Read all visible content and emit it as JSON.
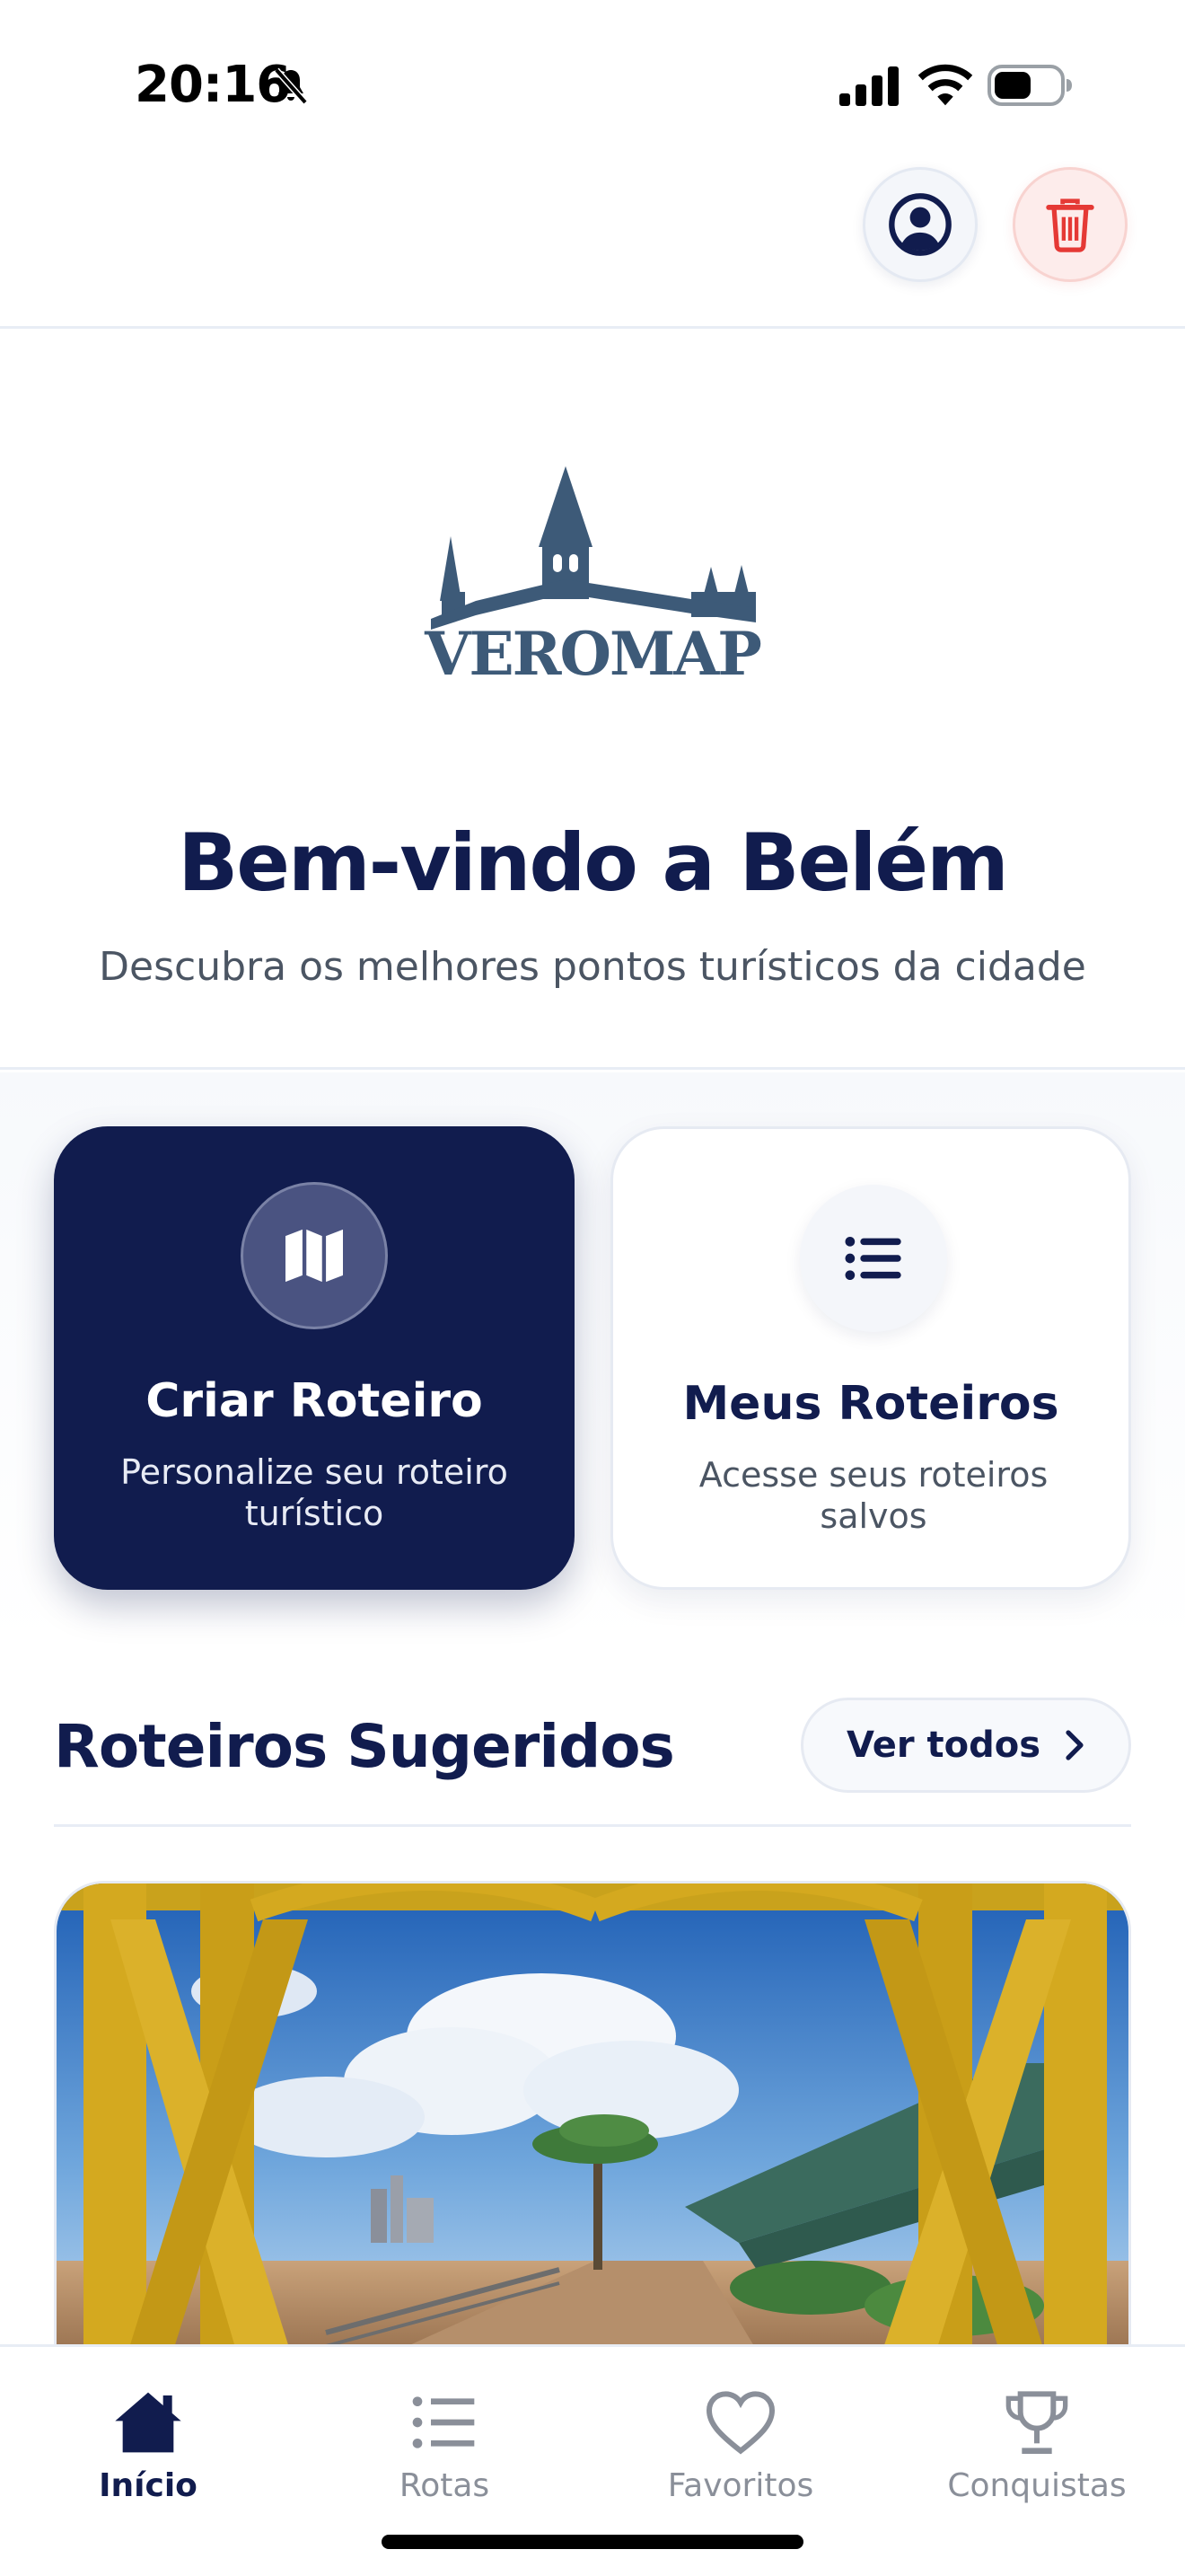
{
  "status_bar": {
    "time": "20:16",
    "icons": [
      "bell-off-icon",
      "signal-icon",
      "wifi-icon",
      "battery-icon"
    ]
  },
  "header": {
    "profile_icon": "user-circle-icon",
    "trash_icon": "trash-icon"
  },
  "hero": {
    "logo_text": "VEROMAP",
    "title": "Bem-vindo a Belém",
    "subtitle": "Descubra os melhores pontos turísticos da cidade"
  },
  "quick_actions": {
    "create": {
      "title": "Criar Roteiro",
      "subtitle": "Personalize seu roteiro turístico",
      "icon": "map-icon"
    },
    "mine": {
      "title": "Meus Roteiros",
      "subtitle": "Acesse seus roteiros salvos",
      "icon": "list-icon"
    }
  },
  "suggested": {
    "title": "Roteiros Sugeridos",
    "see_all": "Ver todos"
  },
  "bottom_nav": {
    "items": [
      {
        "label": "Início",
        "icon": "home-icon",
        "active": true
      },
      {
        "label": "Rotas",
        "icon": "list-icon",
        "active": false
      },
      {
        "label": "Favoritos",
        "icon": "heart-icon",
        "active": false
      },
      {
        "label": "Conquistas",
        "icon": "trophy-icon",
        "active": false
      }
    ]
  },
  "colors": {
    "primary": "#111c4e",
    "logo": "#3d5a78",
    "danger": "#e53935",
    "muted": "#8a8f99"
  }
}
